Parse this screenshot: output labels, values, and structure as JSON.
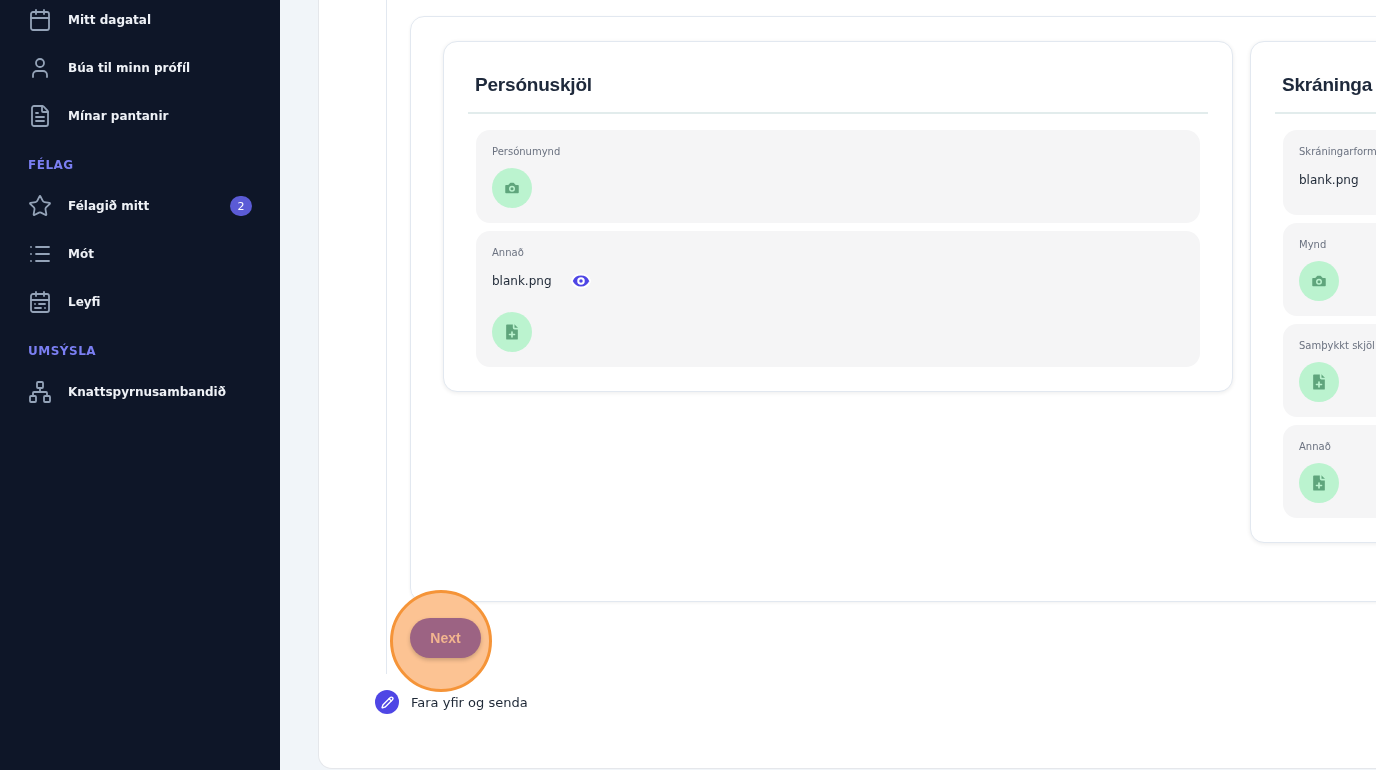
{
  "sidebar": {
    "groups": [
      {
        "items": [
          {
            "label": "Mitt dagatal"
          },
          {
            "label": "Búa til minn prófíl"
          },
          {
            "label": "Mínar pantanir"
          }
        ]
      },
      {
        "heading": "FÉLAG",
        "items": [
          {
            "label": "Félagið mitt",
            "badge": "2"
          },
          {
            "label": "Mót"
          },
          {
            "label": "Leyfi"
          }
        ]
      },
      {
        "heading": "UMSÝSLA",
        "items": [
          {
            "label": "Knattspyrnusambandið"
          }
        ]
      }
    ]
  },
  "sections": [
    {
      "title": "Persónuskjöl",
      "fields": [
        {
          "label": "Persónumynd",
          "upload_button": {
            "kind": "camera"
          }
        },
        {
          "label": "Annað",
          "files": [
            {
              "name": "blank.png"
            }
          ],
          "upload_button": {
            "kind": "file"
          }
        }
      ]
    },
    {
      "title": "Skráninga",
      "fields": [
        {
          "label": "Skráningarform",
          "files": [
            {
              "name": "blank.png"
            }
          ]
        },
        {
          "label": "Mynd",
          "upload_button": {
            "kind": "camera"
          }
        },
        {
          "label": "Samþykkt skjöl",
          "upload_button": {
            "kind": "file"
          }
        },
        {
          "label": "Annað",
          "upload_button": {
            "kind": "file"
          }
        }
      ]
    }
  ],
  "next_button": {
    "label": "Next",
    "highlighted": true
  },
  "step": {
    "label": "Fara yfir og senda"
  }
}
